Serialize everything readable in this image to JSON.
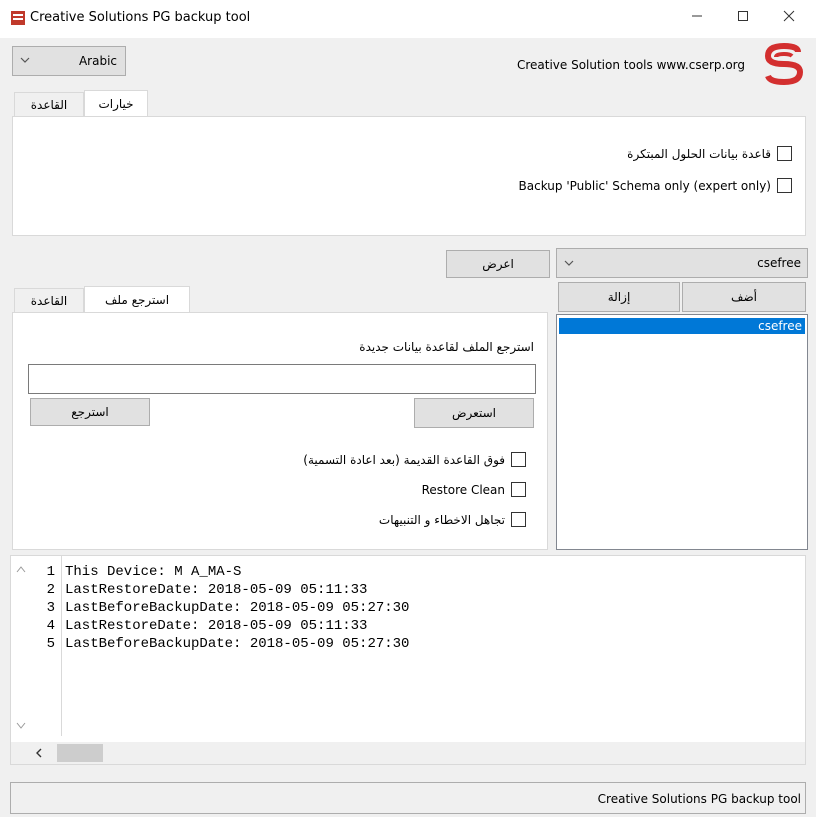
{
  "window": {
    "title": "Creative Solutions PG backup tool",
    "icon": "app-logo-icon",
    "controls": [
      "minimize-icon",
      "maximize-icon",
      "close-icon"
    ]
  },
  "header": {
    "language": "Arabic",
    "brand": "Creative Solution tools www.cserp.org"
  },
  "top_tabs": [
    "خيارات",
    "القاعدة"
  ],
  "options": {
    "checkbox1": "قاعدة بيانات الحلول المبتكرة",
    "checkbox2": "Backup 'Public' Schema only (expert only)"
  },
  "db_controls": {
    "show_button": "اعرض",
    "selected_db": "csefree",
    "add_button": "أضف",
    "remove_button": "إزالة",
    "list": [
      "csefree"
    ]
  },
  "restore_tabs": [
    "استرجع ملف",
    "القاعدة"
  ],
  "restore": {
    "label": "استرجع الملف لقاعدة بيانات جديدة",
    "file_value": "",
    "browse_button": "استعرض",
    "restore_button": "استرجع",
    "opt1": "فوق القاعدة القديمة (بعد اعادة التسمية)",
    "opt2": "Restore Clean",
    "opt3": "تجاهل الاخطاء و التنبيهات"
  },
  "log": {
    "lines": [
      {
        "n": "1",
        "text": "This Device: M A_MA-S"
      },
      {
        "n": "2",
        "text": "LastRestoreDate: 2018-05-09 05:11:33"
      },
      {
        "n": "3",
        "text": "LastBeforeBackupDate: 2018-05-09 05:27:30"
      },
      {
        "n": "4",
        "text": "LastRestoreDate: 2018-05-09 05:11:33"
      },
      {
        "n": "5",
        "text": "LastBeforeBackupDate: 2018-05-09 05:27:30"
      }
    ]
  },
  "status": "Creative Solutions PG backup tool",
  "colors": {
    "selection": "#0078d7",
    "brand_red": "#d32f2f"
  }
}
